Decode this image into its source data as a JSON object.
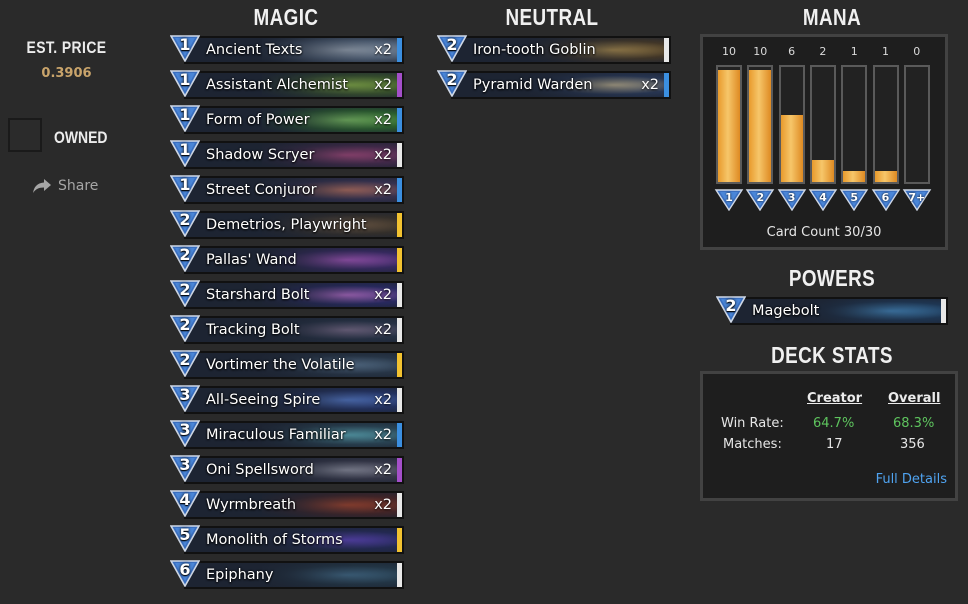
{
  "price": {
    "label": "EST. PRICE",
    "value": "0.3906"
  },
  "owned": {
    "label": "OWNED"
  },
  "share": {
    "label": "Share"
  },
  "sections": {
    "magic": "MAGIC",
    "neutral": "NEUTRAL",
    "mana": "MANA",
    "powers": "POWERS",
    "deck_stats": "DECK STATS"
  },
  "magic_cards": [
    {
      "cost": "1",
      "name": "Ancient Texts",
      "count": "x2",
      "rarity": "#3b8fe0",
      "art": [
        "#5d6f86",
        "#b7c4d2"
      ]
    },
    {
      "cost": "1",
      "name": "Assistant Alchemist",
      "count": "x2",
      "rarity": "#a44fc9",
      "art": [
        "#3d5a2a",
        "#9fd04a"
      ]
    },
    {
      "cost": "1",
      "name": "Form of Power",
      "count": "x2",
      "rarity": "#3b8fe0",
      "art": [
        "#2e6b2c",
        "#8ee06a"
      ]
    },
    {
      "cost": "1",
      "name": "Shadow Scryer",
      "count": "x2",
      "rarity": "#e8e8e8",
      "art": [
        "#4a2a4e",
        "#c04f8a"
      ]
    },
    {
      "cost": "1",
      "name": "Street Conjuror",
      "count": "x2",
      "rarity": "#3b8fe0",
      "art": [
        "#3c3456",
        "#d8806a"
      ]
    },
    {
      "cost": "2",
      "name": "Demetrios, Playwright",
      "count": "",
      "rarity": "#f2c230",
      "art": [
        "#3a3228",
        "#8a6a48"
      ]
    },
    {
      "cost": "2",
      "name": "Pallas' Wand",
      "count": "",
      "rarity": "#f2c230",
      "art": [
        "#3c2a6a",
        "#c05fd8"
      ]
    },
    {
      "cost": "2",
      "name": "Starshard Bolt",
      "count": "x2",
      "rarity": "#e8e8e8",
      "art": [
        "#2a2a6a",
        "#d27ae8"
      ]
    },
    {
      "cost": "2",
      "name": "Tracking Bolt",
      "count": "x2",
      "rarity": "#e8e8e8",
      "art": [
        "#283448",
        "#8c7a9a"
      ]
    },
    {
      "cost": "2",
      "name": "Vortimer the Volatile",
      "count": "",
      "rarity": "#f2c230",
      "art": [
        "#2a3a4c",
        "#6a8aa8"
      ]
    },
    {
      "cost": "3",
      "name": "All-Seeing Spire",
      "count": "x2",
      "rarity": "#e8e8e8",
      "art": [
        "#24346a",
        "#5f8ae8"
      ]
    },
    {
      "cost": "3",
      "name": "Miraculous Familiar",
      "count": "x2",
      "rarity": "#3b8fe0",
      "art": [
        "#2c4a5a",
        "#6acad8"
      ]
    },
    {
      "cost": "3",
      "name": "Oni Spellsword",
      "count": "x2",
      "rarity": "#a44fc9",
      "art": [
        "#3a3a4c",
        "#a8a8b8"
      ]
    },
    {
      "cost": "4",
      "name": "Wyrmbreath",
      "count": "x2",
      "rarity": "#e8e8e8",
      "art": [
        "#4a2424",
        "#c04a2a"
      ]
    },
    {
      "cost": "5",
      "name": "Monolith of Storms",
      "count": "",
      "rarity": "#f2c230",
      "art": [
        "#242a5a",
        "#6a4ad8"
      ]
    },
    {
      "cost": "6",
      "name": "Epiphany",
      "count": "",
      "rarity": "#e8e8e8",
      "art": [
        "#243a4a",
        "#4a7a9a"
      ]
    }
  ],
  "neutral_cards": [
    {
      "cost": "2",
      "name": "Iron-tooth Goblin",
      "count": "",
      "rarity": "#e8e8e8",
      "art": [
        "#4a3a24",
        "#c8a050"
      ]
    },
    {
      "cost": "2",
      "name": "Pyramid Warden",
      "count": "x2",
      "rarity": "#3b8fe0",
      "art": [
        "#2a3a5a",
        "#d8c8a0"
      ]
    }
  ],
  "mana": {
    "bars": [
      {
        "cost": "1",
        "count": "10",
        "fill": 0.97
      },
      {
        "cost": "2",
        "count": "10",
        "fill": 0.97
      },
      {
        "cost": "3",
        "count": "6",
        "fill": 0.58
      },
      {
        "cost": "4",
        "count": "2",
        "fill": 0.19
      },
      {
        "cost": "5",
        "count": "1",
        "fill": 0.1
      },
      {
        "cost": "6",
        "count": "1",
        "fill": 0.1
      },
      {
        "cost": "7+",
        "count": "0",
        "fill": 0
      }
    ],
    "card_count": "Card Count 30/30"
  },
  "powers": [
    {
      "cost": "2",
      "name": "Magebolt",
      "count": "",
      "rarity": "#e8e8e8",
      "art": [
        "#1e3a5a",
        "#4a9ad8"
      ]
    }
  ],
  "stats": {
    "col_creator": "Creator",
    "col_overall": "Overall",
    "win_rate_label": "Win Rate:",
    "win_rate_creator": "64.7%",
    "win_rate_overall": "68.3%",
    "matches_label": "Matches:",
    "matches_creator": "17",
    "matches_overall": "356",
    "full_details": "Full Details"
  },
  "colors": {
    "mana_fill": "#f0b24a",
    "win_green": "#5ec45e",
    "link_blue": "#4fa3f0"
  }
}
